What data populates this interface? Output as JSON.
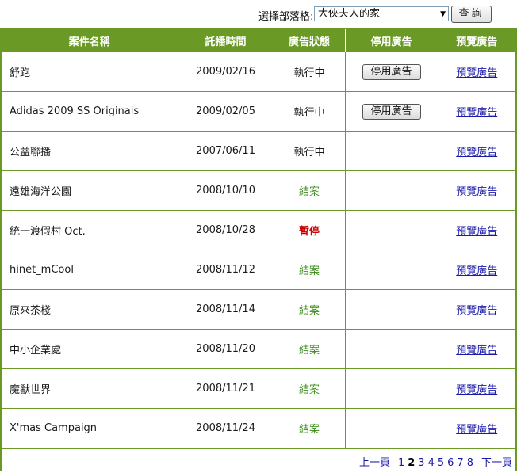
{
  "filter": {
    "label": "選擇部落格:",
    "selected_blog": "大俠夫人的家",
    "query_button": "查詢"
  },
  "table": {
    "headers": {
      "name": "案件名稱",
      "date": "託播時間",
      "status": "廣告狀態",
      "stop": "停用廣告",
      "preview": "預覽廣告"
    },
    "rows": [
      {
        "name": "舒跑",
        "date": "2009/02/16",
        "status": "執行中",
        "status_type": "running",
        "stop_button": "停用廣告",
        "preview": "預覽廣告"
      },
      {
        "name": "Adidas 2009 SS Originals",
        "date": "2009/02/05",
        "status": "執行中",
        "status_type": "running",
        "stop_button": "停用廣告",
        "preview": "預覽廣告"
      },
      {
        "name": "公益聯播",
        "date": "2007/06/11",
        "status": "執行中",
        "status_type": "running",
        "stop_button": "",
        "preview": "預覽廣告"
      },
      {
        "name": "遠雄海洋公園",
        "date": "2008/10/10",
        "status": "結案",
        "status_type": "done",
        "stop_button": "",
        "preview": "預覽廣告"
      },
      {
        "name": "統一渡假村 Oct.",
        "date": "2008/10/28",
        "status": "暫停",
        "status_type": "paused",
        "stop_button": "",
        "preview": "預覽廣告"
      },
      {
        "name": "hinet_mCool",
        "date": "2008/11/12",
        "status": "結案",
        "status_type": "done",
        "stop_button": "",
        "preview": "預覽廣告"
      },
      {
        "name": "原來茶棧",
        "date": "2008/11/14",
        "status": "結案",
        "status_type": "done",
        "stop_button": "",
        "preview": "預覽廣告"
      },
      {
        "name": "中小企業處",
        "date": "2008/11/20",
        "status": "結案",
        "status_type": "done",
        "stop_button": "",
        "preview": "預覽廣告"
      },
      {
        "name": "魔獸世界",
        "date": "2008/11/21",
        "status": "結案",
        "status_type": "done",
        "stop_button": "",
        "preview": "預覽廣告"
      },
      {
        "name": "X'mas Campaign",
        "date": "2008/11/24",
        "status": "結案",
        "status_type": "done",
        "stop_button": "",
        "preview": "預覽廣告"
      }
    ]
  },
  "pagination": {
    "prev": "上一頁",
    "pages": [
      "1",
      "2",
      "3",
      "4",
      "5",
      "6",
      "7",
      "8"
    ],
    "current": "2",
    "next": "下一頁"
  },
  "colors": {
    "accent": "#6a9a25",
    "status_done": "#3c8c1c",
    "status_paused": "#cc0000",
    "link": "#1a1aa8"
  }
}
